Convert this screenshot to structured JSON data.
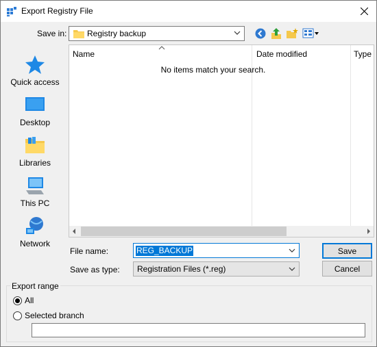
{
  "window": {
    "title": "Export Registry File"
  },
  "save_in": {
    "label": "Save in:",
    "value": "Registry backup"
  },
  "places": [
    {
      "label": "Quick access",
      "icon": "quick-access-star-icon"
    },
    {
      "label": "Desktop",
      "icon": "desktop-icon"
    },
    {
      "label": "Libraries",
      "icon": "libraries-icon"
    },
    {
      "label": "This PC",
      "icon": "this-pc-icon"
    },
    {
      "label": "Network",
      "icon": "network-icon"
    }
  ],
  "file_list": {
    "columns": [
      "Name",
      "Date modified",
      "Type"
    ],
    "empty_message": "No items match your search."
  },
  "file_name": {
    "label": "File name:",
    "value": "REG_BACKUP"
  },
  "save_as_type": {
    "label": "Save as type:",
    "value": "Registration Files (*.reg)"
  },
  "buttons": {
    "save": "Save",
    "cancel": "Cancel"
  },
  "export_range": {
    "title": "Export range",
    "options": [
      "All",
      "Selected branch"
    ],
    "selected": "All",
    "branch_value": ""
  },
  "colors": {
    "accent": "#0078d7",
    "window_bg": "#f0f0f0"
  }
}
